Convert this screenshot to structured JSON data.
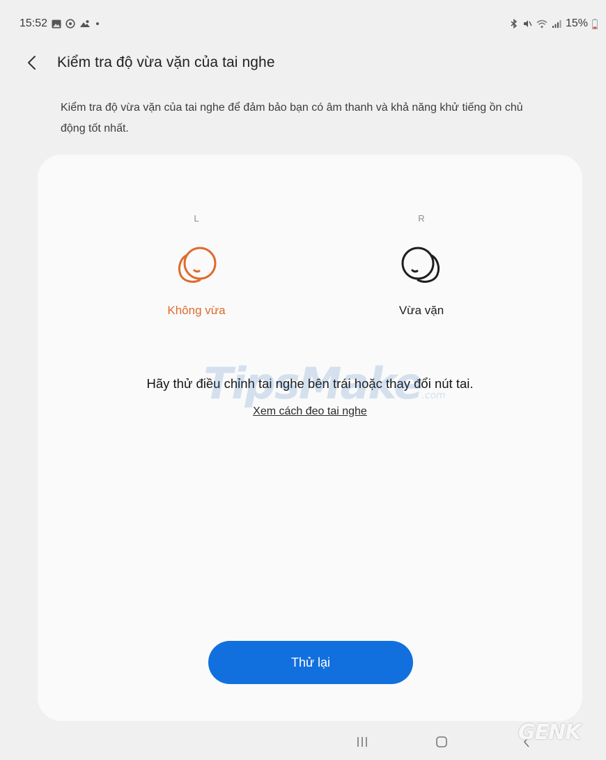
{
  "status_bar": {
    "time": "15:52",
    "left_icons": [
      "gallery-icon",
      "whatsapp-icon",
      "cloud-icon",
      "dot-icon"
    ],
    "right_icons": [
      "bluetooth-icon",
      "mute-icon",
      "wifi-icon",
      "signal-icon",
      "battery-icon"
    ],
    "battery": "15%"
  },
  "header": {
    "title": "Kiểm tra độ vừa vặn của tai nghe"
  },
  "description": "Kiểm tra độ vừa vặn của tai nghe để đảm bảo bạn có âm thanh và khả năng khử tiếng ồn chủ động tốt nhất.",
  "earbuds": {
    "left": {
      "side": "L",
      "status": "Không vừa",
      "color": "#e06a2c"
    },
    "right": {
      "side": "R",
      "status": "Vừa vặn",
      "color": "#1e1e1e"
    }
  },
  "message": "Hãy thử điều chỉnh tai nghe bên trái hoặc thay đổi nút tai.",
  "help_link": "Xem cách đeo tai nghe",
  "retry_button": "Thử lại",
  "accent_color": "#1170dd",
  "watermark": {
    "main": "TipsMake",
    "suffix": ".com"
  },
  "logo": "GENK"
}
